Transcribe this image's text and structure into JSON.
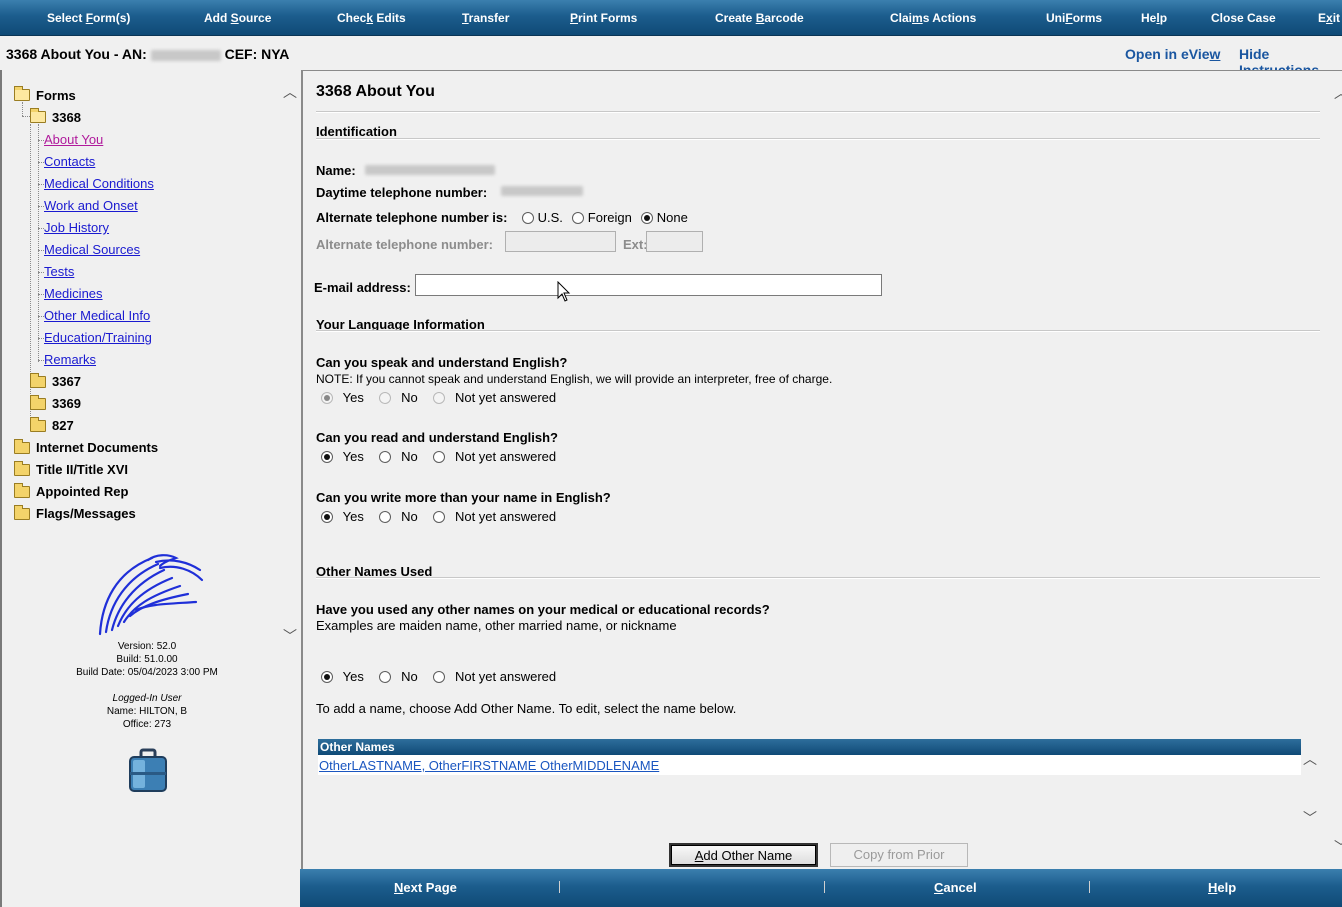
{
  "menu": {
    "items": [
      {
        "pre": "Select ",
        "u": "F",
        "post": "orm(s)"
      },
      {
        "pre": "Add ",
        "u": "S",
        "post": "ource"
      },
      {
        "pre": "Chec",
        "u": "k",
        "post": " Edits"
      },
      {
        "pre": "",
        "u": "T",
        "post": "ransfer"
      },
      {
        "pre": "",
        "u": "P",
        "post": "rint Forms"
      },
      {
        "pre": "Create ",
        "u": "B",
        "post": "arcode"
      },
      {
        "pre": "Clai",
        "u": "m",
        "post": "s Actions"
      },
      {
        "pre": "Uni",
        "u": "F",
        "post": "orms"
      },
      {
        "pre": "He",
        "u": "l",
        "post": "p"
      },
      {
        "pre": "Close Case",
        "u": "",
        "post": ""
      },
      {
        "pre": "E",
        "u": "x",
        "post": "it"
      }
    ]
  },
  "header": {
    "title_prefix": "3368 About You - AN:",
    "title_suffix": "CEF: NYA",
    "open_eview": {
      "pre": "Open in eVie",
      "u": "w",
      "post": ""
    },
    "hide_instructions": {
      "pre": "Hide Instr",
      "u": "u",
      "post": "ctions"
    }
  },
  "tree": {
    "root": "Forms",
    "form_3368": "3368",
    "links": [
      "About You",
      "Contacts",
      "Medical Conditions",
      "Work and Onset",
      "Job History",
      "Medical Sources",
      "Tests",
      "Medicines",
      "Other Medical Info",
      "Education/Training",
      "Remarks"
    ],
    "subfolders": [
      "3367",
      "3369",
      "827"
    ],
    "top_folders": [
      "Internet Documents",
      "Title II/Title XVI",
      "Appointed Rep",
      "Flags/Messages"
    ]
  },
  "version": {
    "version": "Version: 52.0",
    "build": "Build: 51.0.00",
    "build_date": "Build Date: 05/04/2023 3:00 PM",
    "logged_in_label": "Logged-In User",
    "name": "Name: HILTON, B",
    "office": "Office: 273"
  },
  "main": {
    "form_title": "3368 About You",
    "identification": {
      "heading": "Identification",
      "name_label": "Name:",
      "daytime_phone_label": "Daytime telephone number:",
      "alt_phone_is_label": "Alternate telephone number is:",
      "alt_options": [
        "U.S.",
        "Foreign",
        "None"
      ],
      "alt_selected": "None",
      "alt_phone_label": "Alternate telephone number:",
      "ext_label": "Ext:",
      "email_label": "E-mail address:",
      "email_value": ""
    },
    "language": {
      "heading": "Your Language Information",
      "q1": "Can you speak and understand English?",
      "q1_note": "NOTE: If you cannot speak and understand English, we will provide an interpreter, free of charge.",
      "q2": "Can you read and understand English?",
      "q3": "Can you write more than your name in English?",
      "options": [
        "Yes",
        "No",
        "Not yet answered"
      ],
      "q1_answer": "Yes",
      "q2_answer": "Yes",
      "q3_answer": "Yes"
    },
    "other_names": {
      "heading": "Other Names Used",
      "question": "Have you used any other names on your medical or educational records?",
      "examples": "Examples are maiden name, other married name, or nickname",
      "answer": "Yes",
      "instruction": "To add a name, choose Add Other Name. To edit, select the name below.",
      "table_header": "Other Names",
      "rows": [
        "OtherLASTNAME, OtherFIRSTNAME OtherMIDDLENAME"
      ],
      "add_button": {
        "pre": "",
        "u": "A",
        "post": "dd Other Name"
      },
      "copy_button": "Copy from Prior"
    }
  },
  "bottom": {
    "next": {
      "pre": "",
      "u": "N",
      "post": "ext Page"
    },
    "cancel": {
      "pre": "",
      "u": "C",
      "post": "ancel"
    },
    "help": {
      "pre": "",
      "u": "H",
      "post": "elp"
    }
  }
}
